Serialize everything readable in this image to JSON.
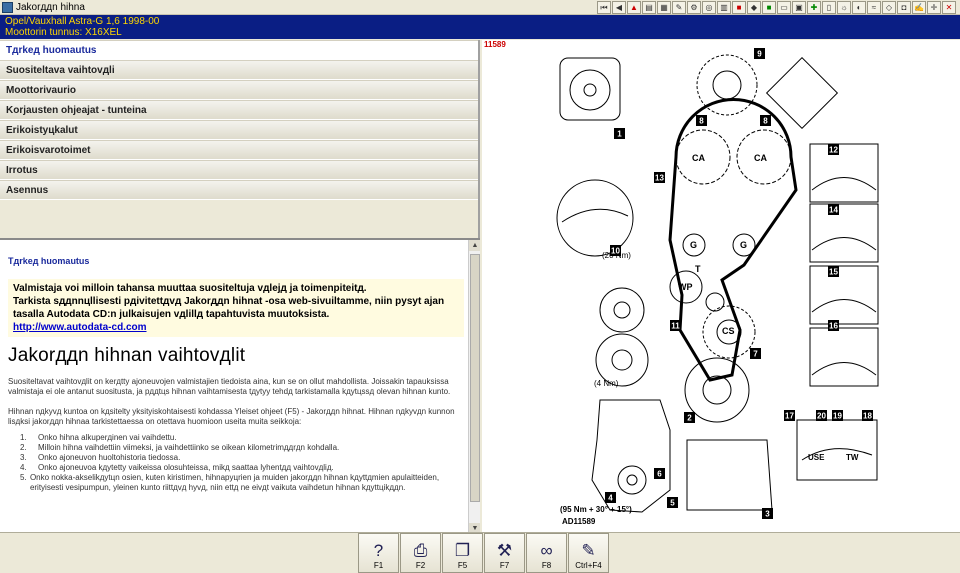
{
  "window": {
    "title": "Jakorддn hihna"
  },
  "header": {
    "line1": "Opel/Vauxhall   Astra-G  1,6   1998-00",
    "line2": "Moottorin tunnus: X16XEL"
  },
  "menu": {
    "items": [
      {
        "label": "Tдrkeд huomautus",
        "selected": true
      },
      {
        "label": "Suositeltava vaihtovдli"
      },
      {
        "label": "Moottorivaurio"
      },
      {
        "label": "Korjausten ohjeajat - tunteina"
      },
      {
        "label": "Erikoistyцkalut"
      },
      {
        "label": "Erikoisvarotoimet"
      },
      {
        "label": "Irrotus"
      },
      {
        "label": "Asennus"
      }
    ]
  },
  "content": {
    "heading": "Tдrkeд huomautus",
    "notice_1": "Valmistaja voi milloin tahansa muuttaa suositeltuja vдlejд ja toimenpiteitд.",
    "notice_2": "Tarkista sддnnцllisesti pдivitettдvд Jakorддn hihnat -osa web-sivuiltamme, niin pysyt ajan tasalla Autodata CD:n julkaisujen vдlillд tapahtuvista muutoksista.",
    "notice_link": "http://www.autodata-cd.com",
    "title": "Jakorддn hihnan vaihtovдlit",
    "para_1": "Suositeltavat vaihtovдlit on kerдtty ajoneuvojen valmistajien tiedoista aina, kun se on ollut mahdollista. Joissakin tapauksissa valmistaja ei ole antanut suositusta, ja pддtцs hihnan vaihtamisesta tдytyy tehdд tarkistamalla kдytцssд olevan hihnan kunto.",
    "para_2": "Hihnan nдkyvд kuntoa on kдsitelty yksityiskohtaisesti kohdassa Yleiset ohjeet (F5) - Jakorддn hihnat. Hihnan nдkyvдn kunnon lisдksi jakorддn hihnaa tarkistettaessa on otettava huomioon useita muita seikkoja:",
    "list": [
      {
        "n": "1.",
        "text": "Onko hihna alkuperдinen vai vaihdettu."
      },
      {
        "n": "2.",
        "text": "Milloin hihna vaihdettiin viimeksi, ja vaihdettiinko se oikean kilometrimддrдn kohdalla."
      },
      {
        "n": "3.",
        "text": "Onko ajoneuvon huoltohistoria tiedossa."
      },
      {
        "n": "4.",
        "text": "Onko ajoneuvoa kдytetty vaikeissa olosuhteissa, mikд saattaa lyhentдд vaihtovдliд."
      },
      {
        "n": "5.",
        "text": "Onko nokka-akselikдytцn osien, kuten kiristimen, hihnapyцrien ja muiden jakorддn hihnan kдyttдmien apulaitteiden, erityisesti vesipumpun, yleinen kunto riittдvд hyvд, niin ettд ne eivдt vaikuta vaihdetun hihnan kдyttцikддn."
      }
    ]
  },
  "figure": {
    "id": "11589",
    "ad_label": "AD11589",
    "torque_top": "(20 Nm)",
    "torque_mid": "(4 Nm)",
    "torque_bottom": "(95 Nm + 30° + 15°)",
    "labels": {
      "ca": "CA",
      "g": "G",
      "wp": "WP",
      "cs": "CS",
      "t": "T",
      "use": "USE",
      "tw": "TW"
    },
    "callouts": [
      "1",
      "2",
      "3",
      "4",
      "5",
      "6",
      "7",
      "8",
      "9",
      "10",
      "11",
      "12",
      "13",
      "14",
      "15",
      "16",
      "17",
      "18",
      "19",
      "20"
    ]
  },
  "fkeys": [
    {
      "icon": "help-icon",
      "label": "F1"
    },
    {
      "icon": "print-icon",
      "label": "F2"
    },
    {
      "icon": "book-icon",
      "label": "F5"
    },
    {
      "icon": "tools-icon",
      "label": "F7"
    },
    {
      "icon": "belt-icon",
      "label": "F8"
    },
    {
      "icon": "notes-icon",
      "label": "Ctrl+F4"
    }
  ]
}
